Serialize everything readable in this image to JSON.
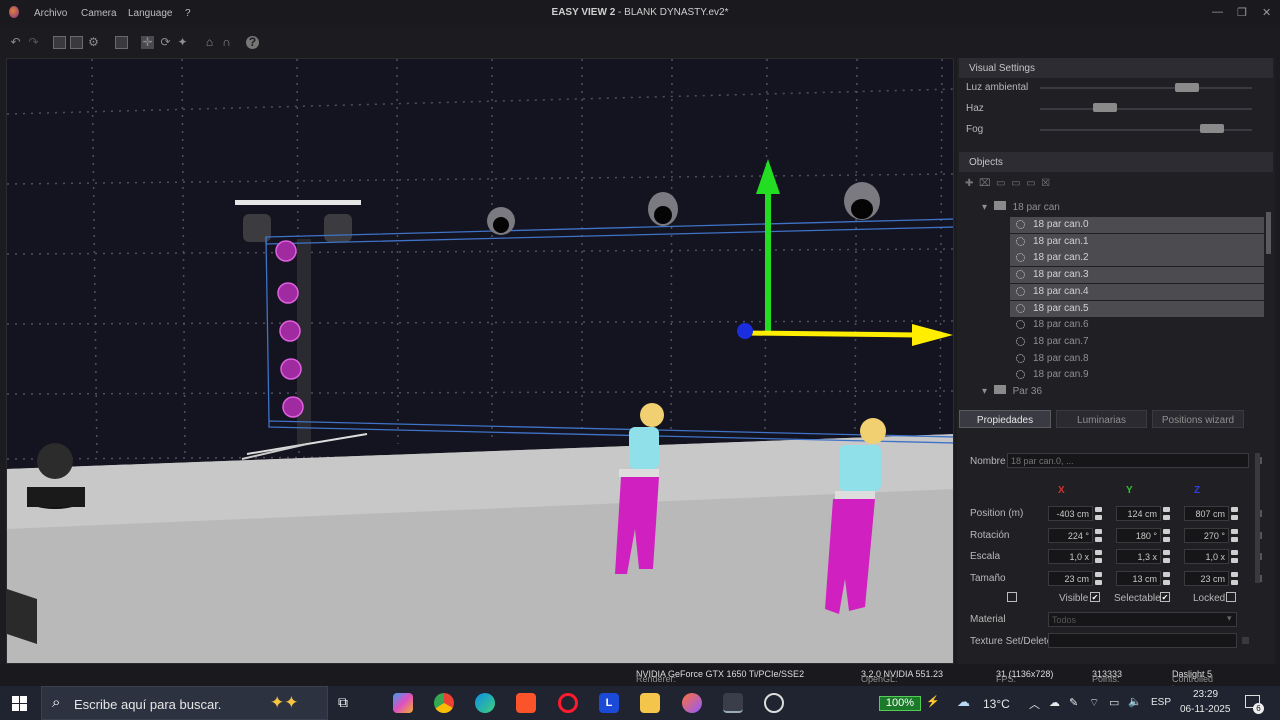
{
  "window": {
    "title_bold": "EASY VIEW 2",
    "title_rest": " - BLANK DYNASTY.ev2*",
    "menu": [
      "Archivo",
      "Camera",
      "Language",
      "?"
    ]
  },
  "visual_settings": {
    "title": "Visual Settings",
    "sliders": [
      {
        "label": "Luz ambiental",
        "level": 0.72
      },
      {
        "label": "Haz",
        "level": 0.28
      },
      {
        "label": "Fog",
        "level": 0.85
      }
    ]
  },
  "objects": {
    "title": "Objects",
    "group": "18 par can",
    "items": [
      {
        "label": "18 par can.0",
        "selected": true
      },
      {
        "label": "18 par can.1",
        "selected": true
      },
      {
        "label": "18 par can.2",
        "selected": true
      },
      {
        "label": "18 par can.3",
        "selected": true
      },
      {
        "label": "18 par can.4",
        "selected": true
      },
      {
        "label": "18 par can.5",
        "selected": true
      },
      {
        "label": "18 par can.6",
        "selected": false
      },
      {
        "label": "18 par can.7",
        "selected": false
      },
      {
        "label": "18 par can.8",
        "selected": false
      },
      {
        "label": "18 par can.9",
        "selected": false
      }
    ],
    "group2": "Par 36"
  },
  "tabs": [
    "Propiedades",
    "Luminarias",
    "Positions wizard"
  ],
  "properties": {
    "nombre_label": "Nombre",
    "nombre_placeholder": "18 par can.0, ...",
    "axes": [
      "X",
      "Y",
      "Z"
    ],
    "axis_colors": [
      "#d43030",
      "#30c030",
      "#3040e0"
    ],
    "rows": [
      {
        "label": "Position (m)",
        "values": [
          "-403 cm",
          "124 cm",
          "807 cm"
        ]
      },
      {
        "label": "Rotación",
        "values": [
          "224 °",
          "180 °",
          "270 °"
        ]
      },
      {
        "label": "Escala",
        "values": [
          "1,0 x",
          "1,3 x",
          "1,0 x"
        ]
      },
      {
        "label": "Tamaño",
        "values": [
          "23 cm",
          "13 cm",
          "23 cm"
        ]
      }
    ],
    "visible_label": "Visible",
    "selectable_label": "Selectable",
    "locked_label": "Locked",
    "material_label": "Material",
    "material_value": "Todos",
    "texture_label": "Texture Set/Delete"
  },
  "status": {
    "renderer_label": "Renderer:",
    "renderer_value": "NVIDIA GeForce GTX 1650 Ti/PCIe/SSE2",
    "opengl_label": "OpenGL:",
    "opengl_value": "3.2.0 NVIDIA 551.23",
    "fps_label": "FPS:",
    "fps_value": "31 (1136x728)",
    "points_label": "Points:",
    "points_value": "313333",
    "controlled_label": "Controlled by",
    "controlled_value": "Daslight 5"
  },
  "taskbar": {
    "search_placeholder": "Escribe aquí para buscar.",
    "battery": "100%",
    "weather": "13°C",
    "lang": "ESP",
    "time": "23:29",
    "date": "06-11-2025",
    "notif": "6"
  }
}
